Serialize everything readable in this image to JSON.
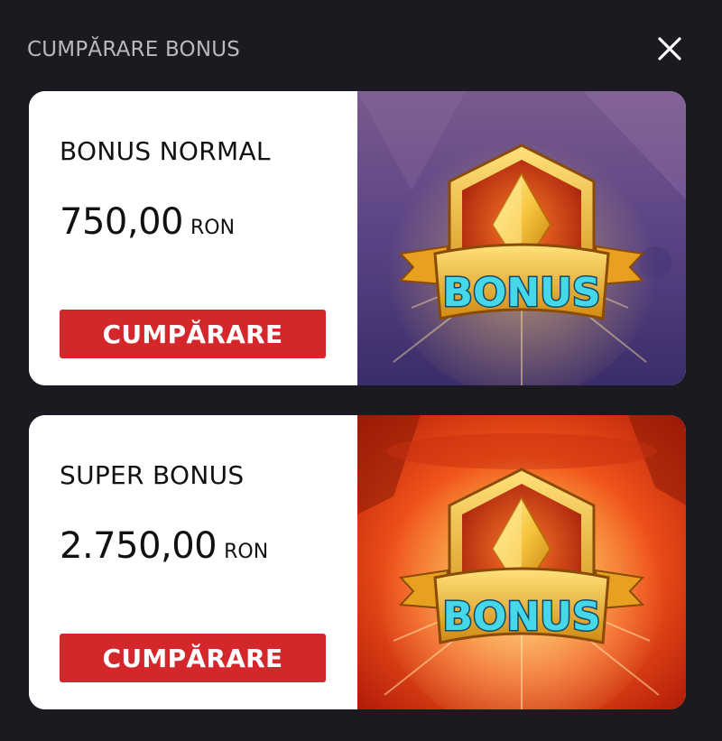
{
  "header": {
    "title": "CUMPĂRARE BONUS",
    "close_icon": "close-icon"
  },
  "offers": [
    {
      "title": "BONUS NORMAL",
      "price": "750,00",
      "currency": "RON",
      "button_label": "CUMPĂRARE",
      "art_label": "BONUS",
      "art_theme": "purple",
      "art_colors": {
        "bg_top": "#6a4f8a",
        "bg_bottom": "#3a2a66"
      }
    },
    {
      "title": "SUPER BONUS",
      "price": "2.750,00",
      "currency": "RON",
      "button_label": "CUMPĂRARE",
      "art_label": "BONUS",
      "art_theme": "red",
      "art_colors": {
        "bg_top": "#ff7a1a",
        "bg_bottom": "#c21e08"
      }
    }
  ],
  "colors": {
    "background": "#1b1a20",
    "button": "#d3272b",
    "card": "#ffffff",
    "header_text": "#b8b8bd"
  }
}
